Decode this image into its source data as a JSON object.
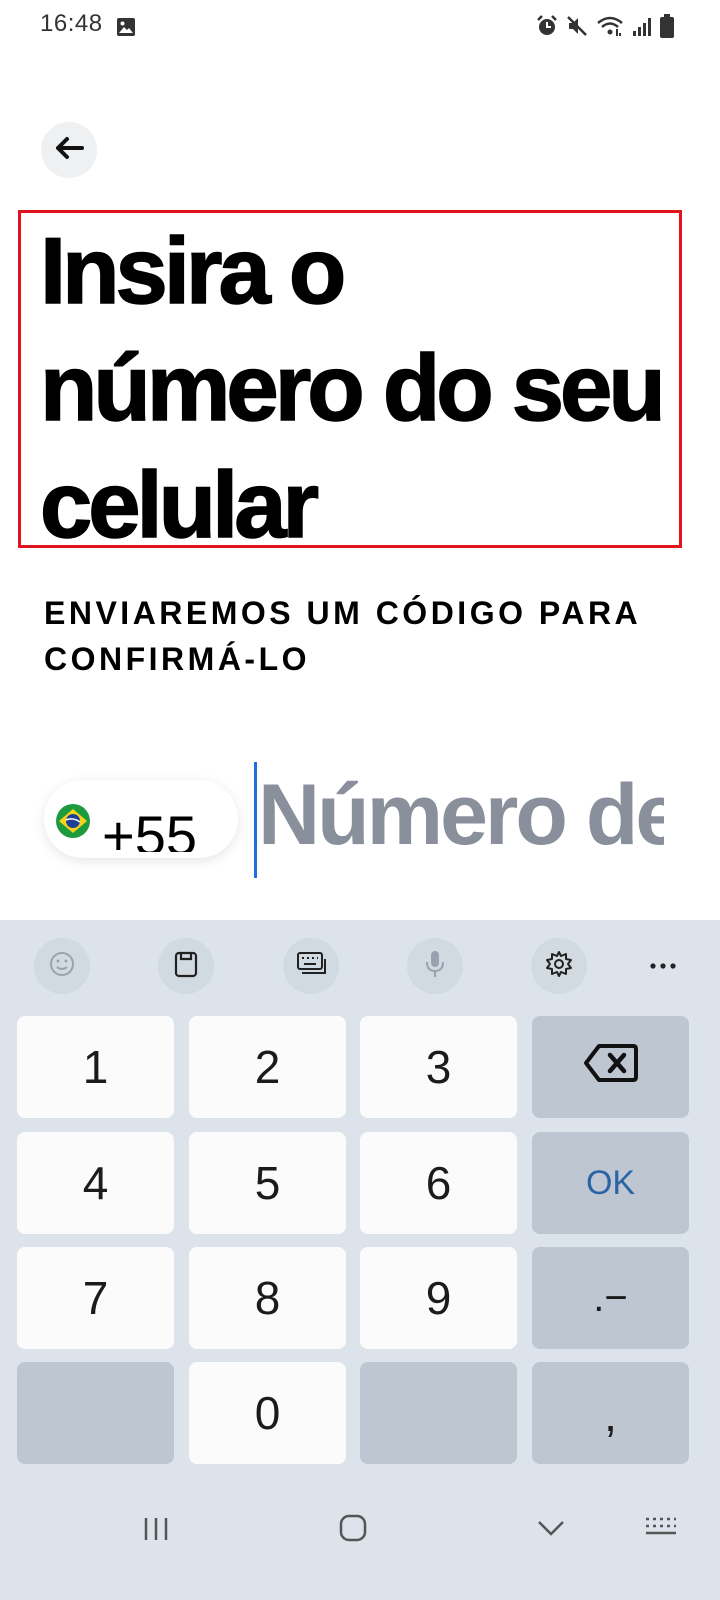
{
  "status_bar": {
    "time": "16:48",
    "icons": [
      "image-icon",
      "alarm-icon",
      "mute-icon",
      "wifi-icon",
      "signal-icon",
      "battery-icon"
    ]
  },
  "header": {
    "back_icon": "arrow-left-icon"
  },
  "title": "Insira o número do seu celular",
  "subtitle": "ENVIAREMOS UM CÓDIGO PARA CONFIRMÁ-LO",
  "phone_input": {
    "country_flag": "brazil-flag-icon",
    "country_code": "+55",
    "placeholder": "Número de",
    "value": ""
  },
  "keyboard": {
    "toolbar": [
      "emoji-icon",
      "clipboard-icon",
      "keyboard-mode-icon",
      "microphone-icon",
      "settings-icon",
      "more-icon"
    ],
    "keys": {
      "k1": "1",
      "k2": "2",
      "k3": "3",
      "k4": "4",
      "k5": "5",
      "k6": "6",
      "k7": "7",
      "k8": "8",
      "k9": "9",
      "k0": "0",
      "ok": "OK",
      "dot_dash": ".−",
      "comma": ","
    }
  },
  "nav_bar": [
    "recent-apps-icon",
    "home-icon",
    "hide-keyboard-icon",
    "keyboard-switch-icon"
  ],
  "colors": {
    "highlight_box": "#e1141e",
    "caret": "#1f6fe0",
    "ok_key": "#2a64a6",
    "keyboard_bg": "#dde3ea"
  }
}
